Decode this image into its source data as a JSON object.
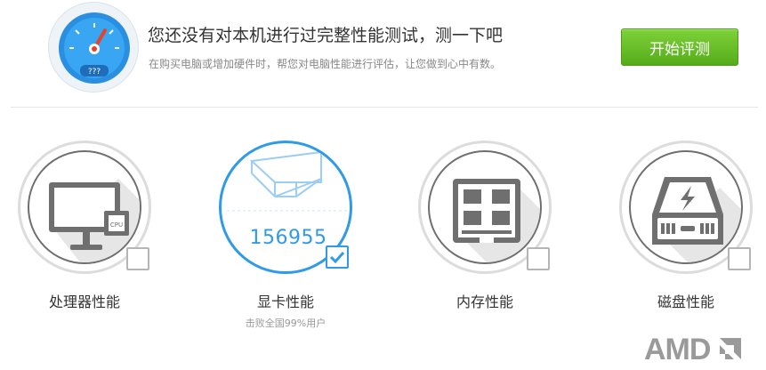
{
  "header": {
    "headline": "您还没有对本机进行过完整性能测试，测一下吧",
    "subline": "在购买电脑或增加硬件时，帮您对电脑性能进行评估，让您做到心中有数。",
    "start_button": "开始评测",
    "gauge_text": "???",
    "gauge_icon": "speedometer-icon"
  },
  "cards": [
    {
      "label": "处理器性能",
      "icon": "cpu-monitor-icon",
      "chip_text": "CPU",
      "checked": false
    },
    {
      "label": "显卡性能",
      "icon": "graphics-card-icon",
      "score": "156955",
      "sub": "击败全国99%用户",
      "checked": true
    },
    {
      "label": "内存性能",
      "icon": "memory-chip-icon",
      "checked": false
    },
    {
      "label": "磁盘性能",
      "icon": "hard-disk-icon",
      "checked": false
    }
  ],
  "brand": {
    "logo_text": "AMD"
  },
  "colors": {
    "accent_green": "#55ac1a",
    "accent_blue": "#2f9be8",
    "icon_gray": "#6f6f6f"
  }
}
